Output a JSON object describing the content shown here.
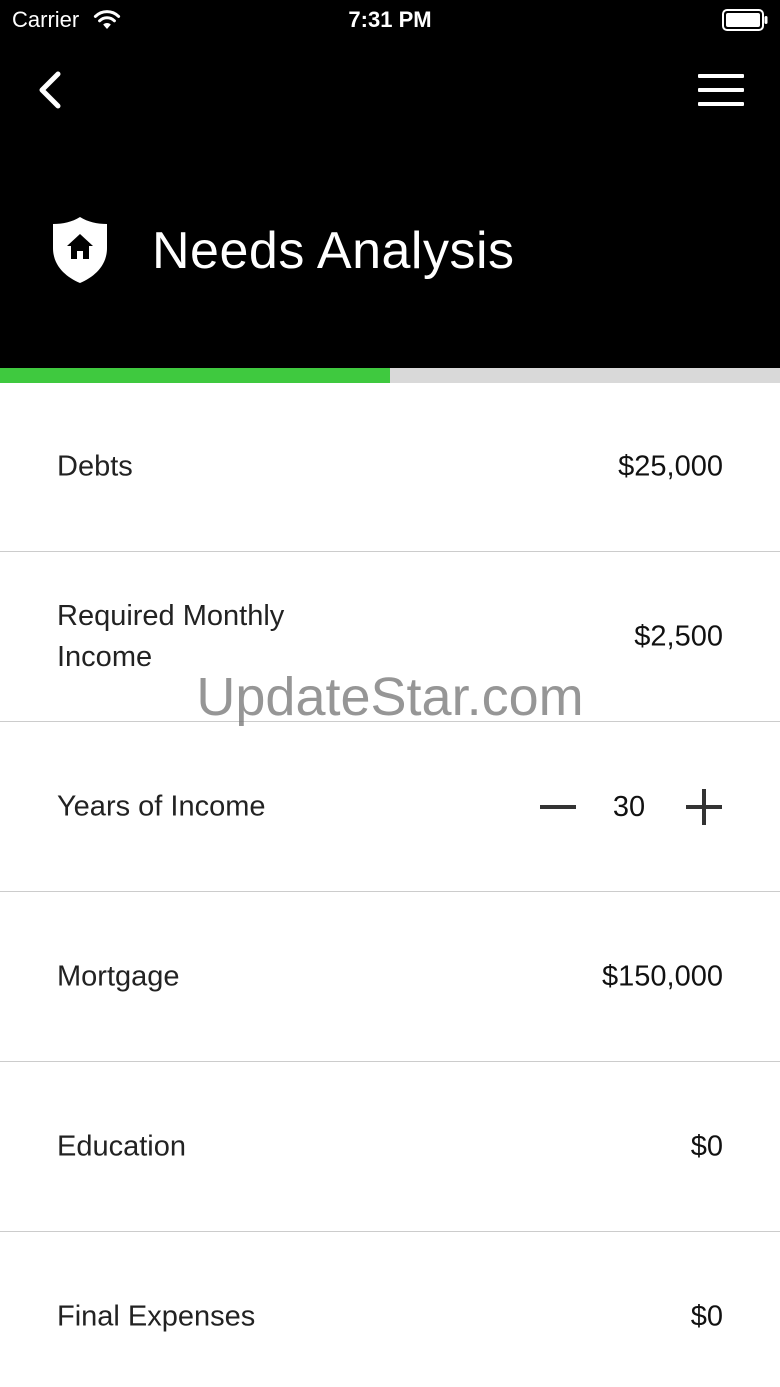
{
  "status_bar": {
    "carrier": "Carrier",
    "time": "7:31 PM",
    "wifi_icon": "wifi-icon",
    "battery_icon": "battery-icon"
  },
  "header": {
    "title": "Needs Analysis",
    "title_icon": "shield-home-icon",
    "back_icon": "chevron-left-icon",
    "menu_icon": "hamburger-menu-icon",
    "background_color": "#000000"
  },
  "progress": {
    "fraction": 0.5,
    "fill_color": "#3fc93f",
    "track_color": "#d9d9d9"
  },
  "rows": [
    {
      "label": "Debts",
      "value": "$25,000"
    },
    {
      "label": "Required Monthly Income",
      "value": "$2,500"
    },
    {
      "label": "Years of Income",
      "value": "30"
    },
    {
      "label": "Mortgage",
      "value": "$150,000"
    },
    {
      "label": "Education",
      "value": "$0"
    },
    {
      "label": "Final Expenses",
      "value": "$0"
    }
  ],
  "watermark": "UpdateStar.com"
}
